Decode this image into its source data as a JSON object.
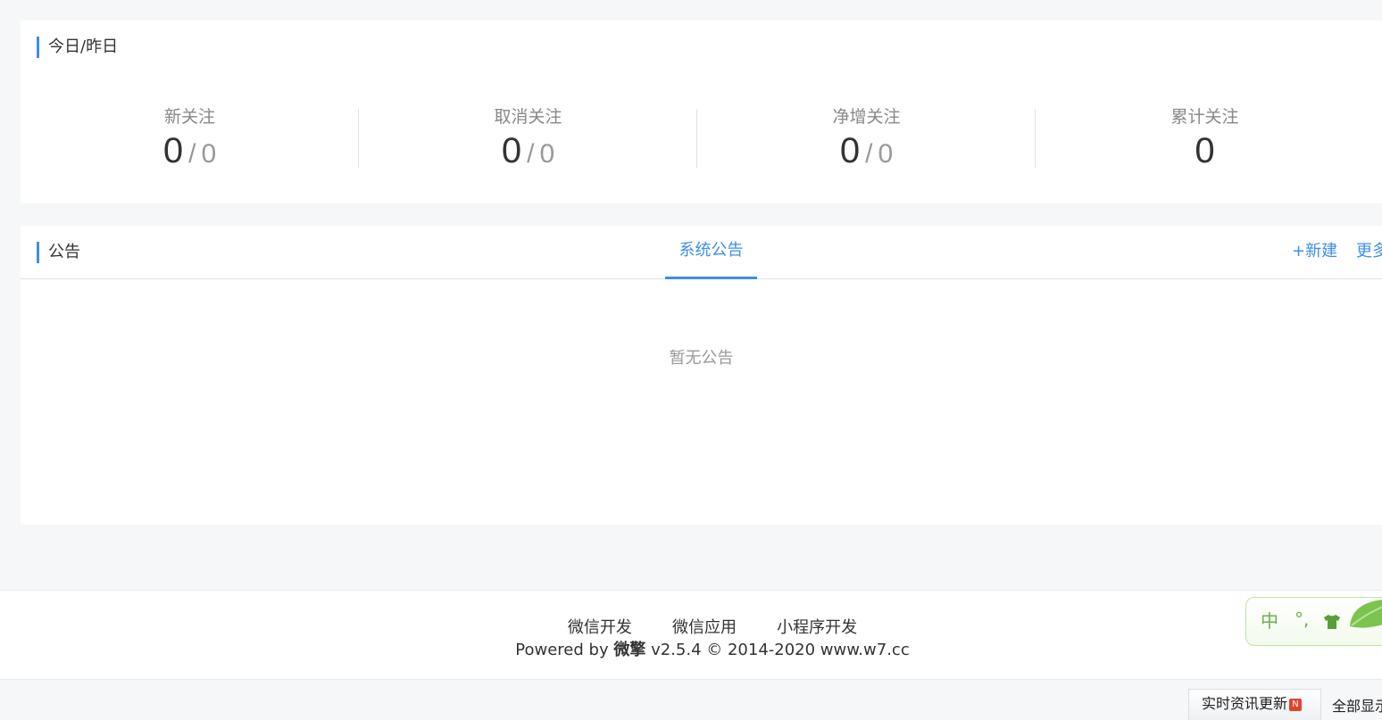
{
  "stats": {
    "title": "今日/昨日",
    "items": [
      {
        "label": "新关注",
        "today": "0",
        "sep": "/",
        "yesterday": "0"
      },
      {
        "label": "取消关注",
        "today": "0",
        "sep": "/",
        "yesterday": "0"
      },
      {
        "label": "净增关注",
        "today": "0",
        "sep": "/",
        "yesterday": "0"
      },
      {
        "label": "累计关注",
        "total": "0"
      }
    ]
  },
  "notice": {
    "title": "公告",
    "tab_label": "系统公告",
    "new_label": "+新建",
    "more_label": "更多",
    "empty_text": "暂无公告"
  },
  "footer": {
    "links": [
      "微信开发",
      "微信应用",
      "小程序开发"
    ],
    "powered_prefix": "Powered by ",
    "brand": "微擎",
    "powered_suffix": " v2.5.4 © 2014-2020 www.w7.cc"
  },
  "ime": {
    "mode": "中",
    "punct": "°,"
  },
  "bottom_bar": {
    "news_label": "实时资讯更新",
    "news_badge": "N",
    "show_all_label": "全部显示"
  },
  "colors": {
    "accent": "#3d8ee8",
    "page_bg": "#f6f7f9",
    "ime_green": "#6ab04c"
  }
}
